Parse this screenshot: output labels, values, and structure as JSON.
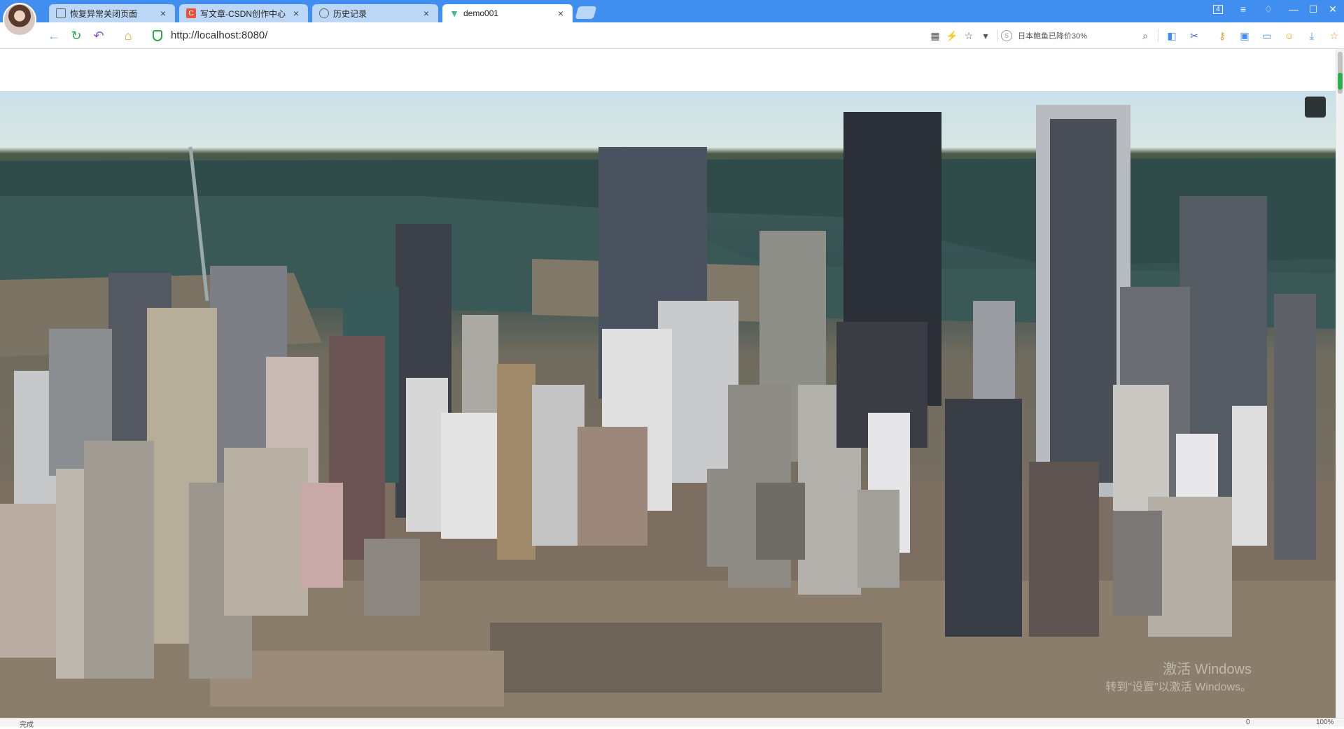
{
  "tabs": [
    {
      "title": "恢复异常关闭页面",
      "icon": "page-icon",
      "active": false
    },
    {
      "title": "写文章-CSDN创作中心",
      "icon": "csdn-icon",
      "active": false
    },
    {
      "title": "历史记录",
      "icon": "history-icon",
      "active": false
    },
    {
      "title": "demo001",
      "icon": "vue-icon",
      "active": true
    }
  ],
  "tab_badge": "4",
  "address": {
    "url": "http://localhost:8080/"
  },
  "search": {
    "text": "日本鲍鱼已降价30%"
  },
  "status": {
    "left": "完成",
    "zoom": "100%",
    "downloads": "0"
  },
  "watermark": {
    "line1": "激活 Windows",
    "line2": "转到\"设置\"以激活 Windows。"
  },
  "colors": {
    "tabbar": "#3f8ef0",
    "settings_btn": "#2d3436",
    "secure": "#2aa84a"
  }
}
